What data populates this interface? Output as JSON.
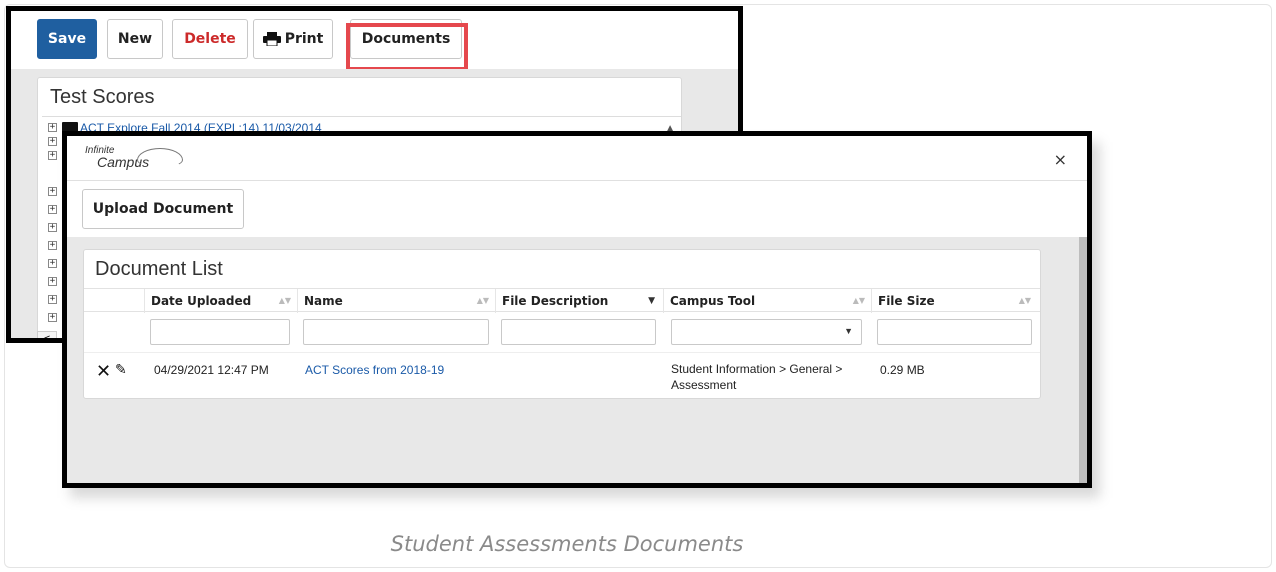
{
  "toolbar": {
    "save_label": "Save",
    "new_label": "New",
    "delete_label": "Delete",
    "print_label": "Print",
    "documents_label": "Documents"
  },
  "test_scores": {
    "title": "Test Scores",
    "first_item": "ACT Explore Fall 2014 (EXPL:14) 11/03/2014"
  },
  "modal": {
    "logo_line1": "Infinite",
    "logo_line2": "Campus",
    "close_symbol": "×",
    "upload_label": "Upload Document",
    "list_title": "Document List",
    "columns": [
      "Date Uploaded",
      "Name",
      "File Description",
      "Campus Tool",
      "File Size"
    ],
    "rows": [
      {
        "date_uploaded": "04/29/2021 12:47 PM",
        "name": "ACT Scores from 2018-19",
        "file_description": "",
        "campus_tool": "Student Information > General > Assessment",
        "file_size": "0.29 MB"
      }
    ]
  },
  "caption": "Student Assessments Documents",
  "colors": {
    "save_bg": "#1f5fa0",
    "delete_text": "#cc2a2a",
    "highlight": "#e5484d",
    "link": "#1a5aa8"
  }
}
